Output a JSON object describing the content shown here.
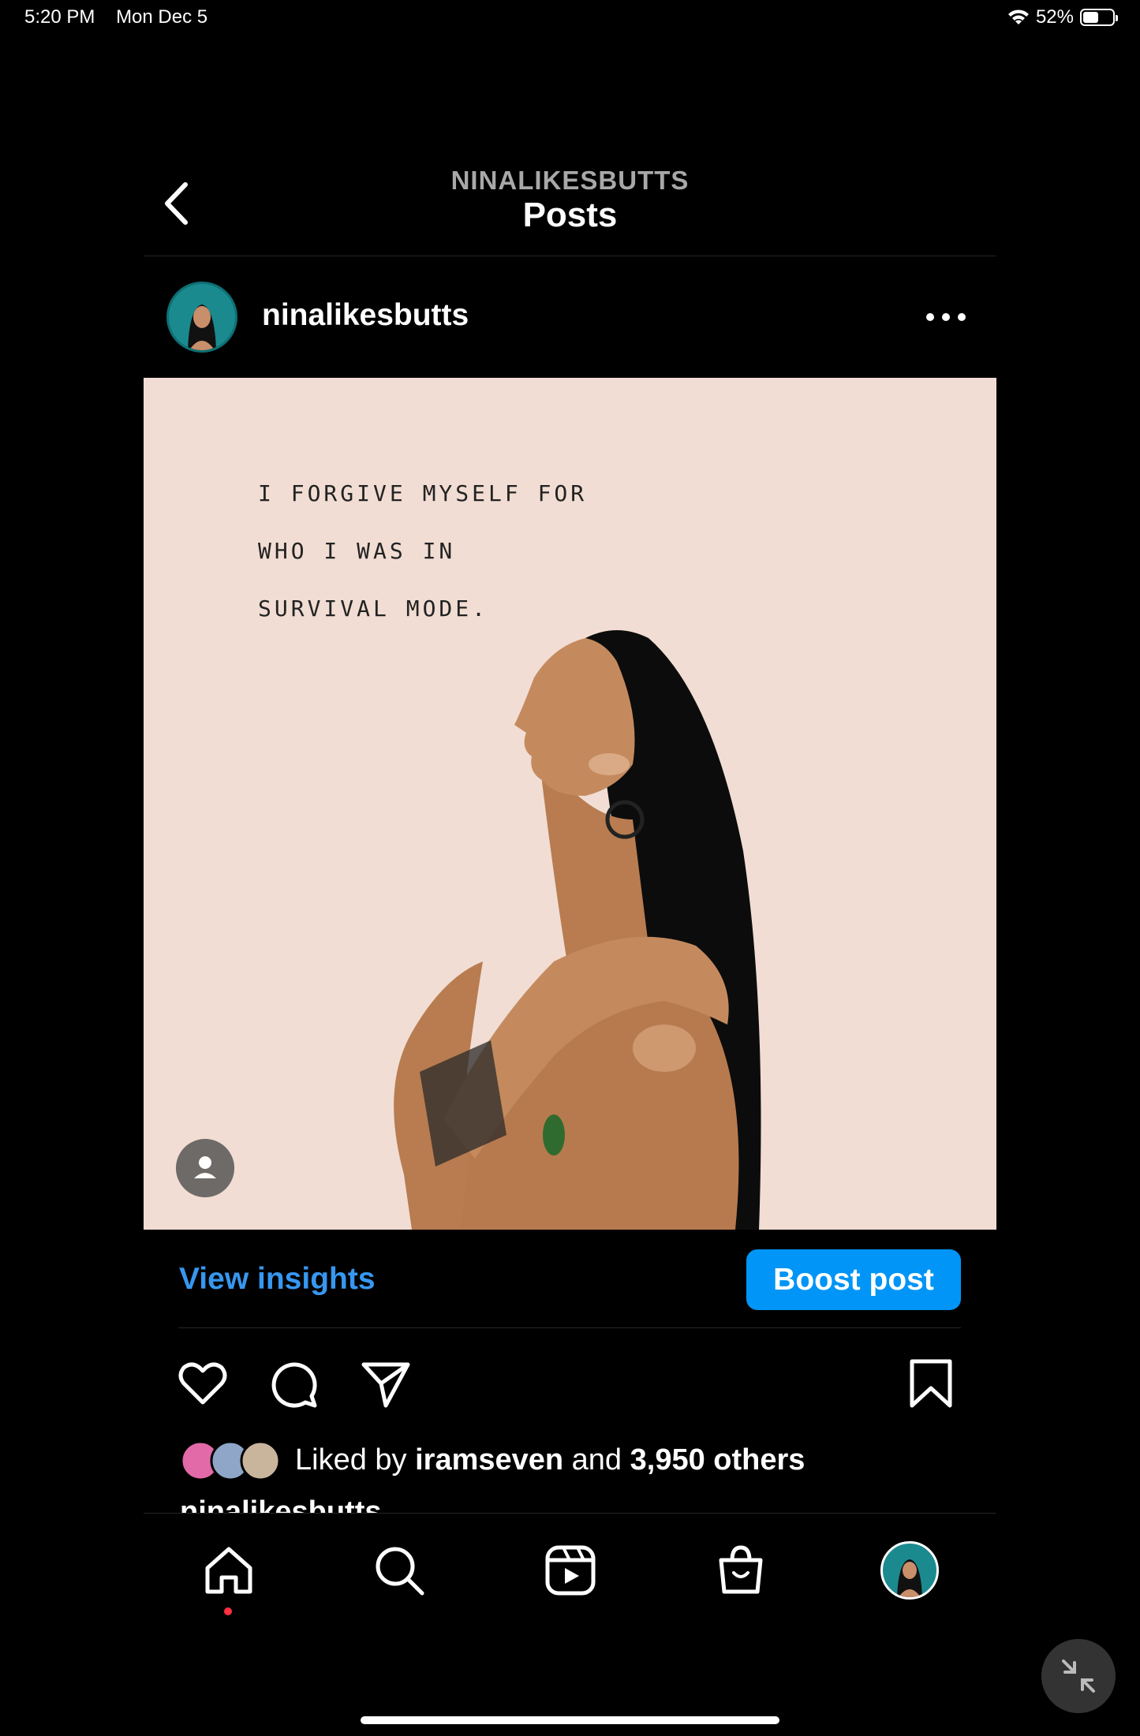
{
  "status_bar": {
    "time": "5:20 PM",
    "date": "Mon Dec 5",
    "battery_text": "52%",
    "battery_level": 0.52
  },
  "header": {
    "username": "NINALIKESBUTTS",
    "title": "Posts"
  },
  "post": {
    "username": "ninalikesbutts",
    "quote_lines": [
      "I FORGIVE MYSELF FOR",
      "WHO I WAS IN",
      "SURVIVAL MODE."
    ],
    "view_insights_label": "View insights",
    "boost_label": "Boost post",
    "likes_prefix": "Liked by ",
    "likes_user": "iramseven",
    "likes_mid": " and ",
    "likes_count": "3,950 others",
    "caption_user": "ninalikesbutts"
  },
  "icons": [
    "back-icon",
    "more-icon",
    "person-tag-icon",
    "heart-icon",
    "comment-icon",
    "share-icon",
    "bookmark-icon",
    "home-icon",
    "search-icon",
    "reels-icon",
    "shop-icon",
    "collapse-icon",
    "wifi-icon",
    "battery-icon"
  ],
  "colors": {
    "accent": "#0095f6",
    "link": "#3797f0",
    "notification": "#ff3040",
    "avatar_bg": "#1b8a8f",
    "image_bg": "#f1ddd3"
  }
}
